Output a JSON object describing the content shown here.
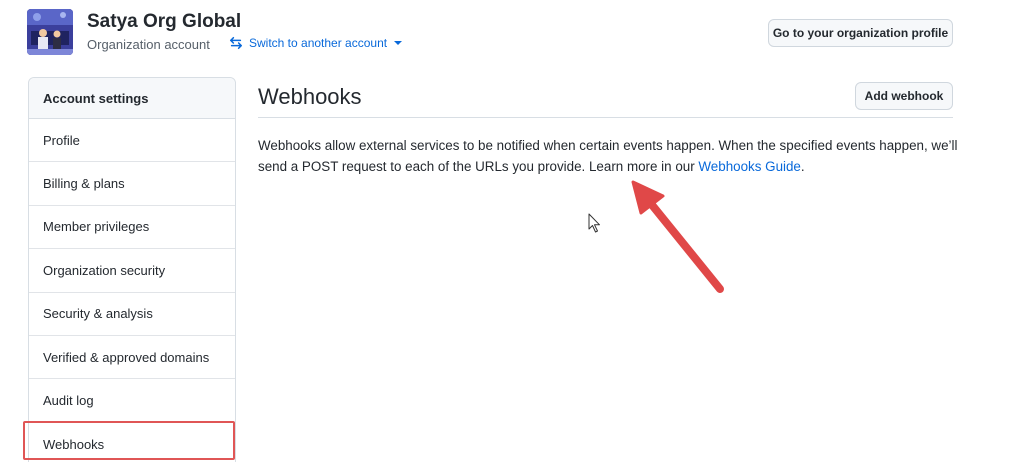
{
  "header": {
    "org_name": "Satya Org Global",
    "org_subtitle": "Organization account",
    "switch_label": "Switch to another account",
    "profile_button": "Go to your organization profile"
  },
  "sidebar": {
    "title": "Account settings",
    "items": [
      {
        "label": "Profile"
      },
      {
        "label": "Billing & plans"
      },
      {
        "label": "Member privileges"
      },
      {
        "label": "Organization security"
      },
      {
        "label": "Security & analysis"
      },
      {
        "label": "Verified & approved domains"
      },
      {
        "label": "Audit log"
      },
      {
        "label": "Webhooks"
      }
    ],
    "selected": "Webhooks"
  },
  "main": {
    "title": "Webhooks",
    "add_button": "Add webhook",
    "description_text": "Webhooks allow external services to be notified when certain events happen. When the specified events happen, we’ll send a POST request to each of the URLs you provide. Learn more in our ",
    "description_link": "Webhooks Guide",
    "description_end": "."
  },
  "colors": {
    "link": "#0969da",
    "annotation_red": "#e04848",
    "border": "#d0d7de"
  },
  "icons": [
    "avatar",
    "switch-arrows-icon",
    "chevron-down-icon",
    "mouse-pointer-icon",
    "annotation-arrow"
  ]
}
